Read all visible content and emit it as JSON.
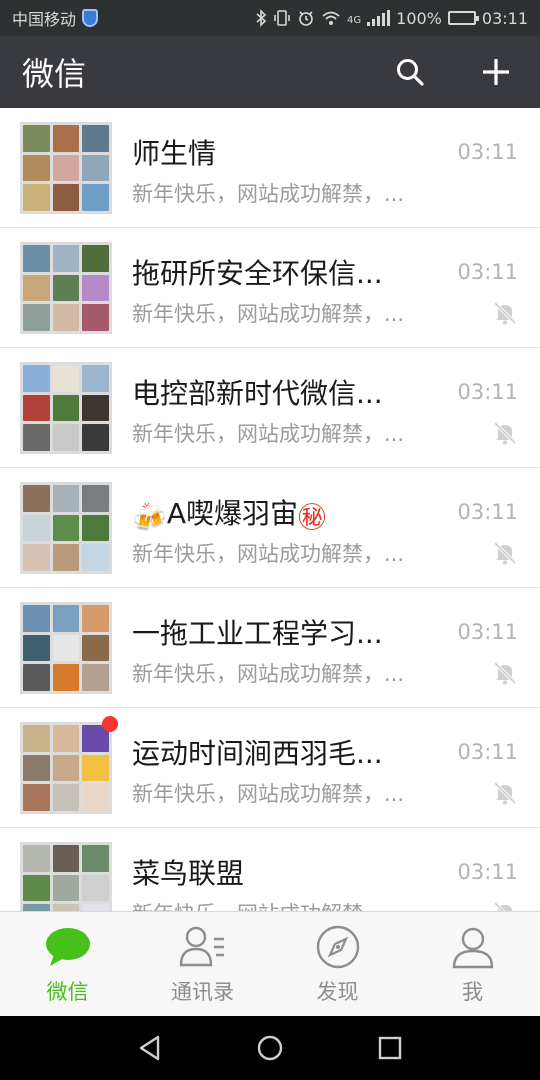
{
  "status_bar": {
    "carrier": "中国移动",
    "network": "4G",
    "battery": "100%",
    "time": "03:11",
    "battery_level": 1.0
  },
  "header": {
    "title": "微信",
    "icons": [
      "search-icon",
      "plus-icon"
    ]
  },
  "chats": [
    {
      "name": "师生情",
      "time": "03:11",
      "preview": "新年快乐，网站成功解禁，...",
      "muted": false,
      "unread": false
    },
    {
      "name": "拖研所安全环保信...",
      "time": "03:11",
      "preview": "新年快乐，网站成功解禁，...",
      "muted": true,
      "unread": false
    },
    {
      "name": "电控部新时代微信...",
      "time": "03:11",
      "preview": "新年快乐，网站成功解禁，...",
      "muted": true,
      "unread": false
    },
    {
      "name_prefix": "🍻",
      "name": "A喫爆羽宙",
      "name_suffix": "㊙",
      "time": "03:11",
      "preview": "新年快乐，网站成功解禁，...",
      "muted": true,
      "unread": false
    },
    {
      "name": "一拖工业工程学习...",
      "time": "03:11",
      "preview": "新年快乐，网站成功解禁，...",
      "muted": true,
      "unread": false
    },
    {
      "name": "运动时间涧西羽毛...",
      "time": "03:11",
      "preview": "新年快乐，网站成功解禁，...",
      "muted": true,
      "unread": true
    },
    {
      "name": "菜鸟联盟",
      "time": "03:11",
      "preview": "新年快乐，网站成功解禁，...",
      "muted": true,
      "unread": false
    }
  ],
  "tabs": [
    {
      "label": "微信",
      "icon": "chat-bubble-icon",
      "active": true
    },
    {
      "label": "通讯录",
      "icon": "contacts-icon",
      "active": false
    },
    {
      "label": "发现",
      "icon": "compass-icon",
      "active": false
    },
    {
      "label": "我",
      "icon": "person-icon",
      "active": false
    }
  ],
  "colors": {
    "header_bg": "#393a3f",
    "status_bg": "#2e3132",
    "accent_green": "#46c01b",
    "unread_red": "#f43530"
  }
}
